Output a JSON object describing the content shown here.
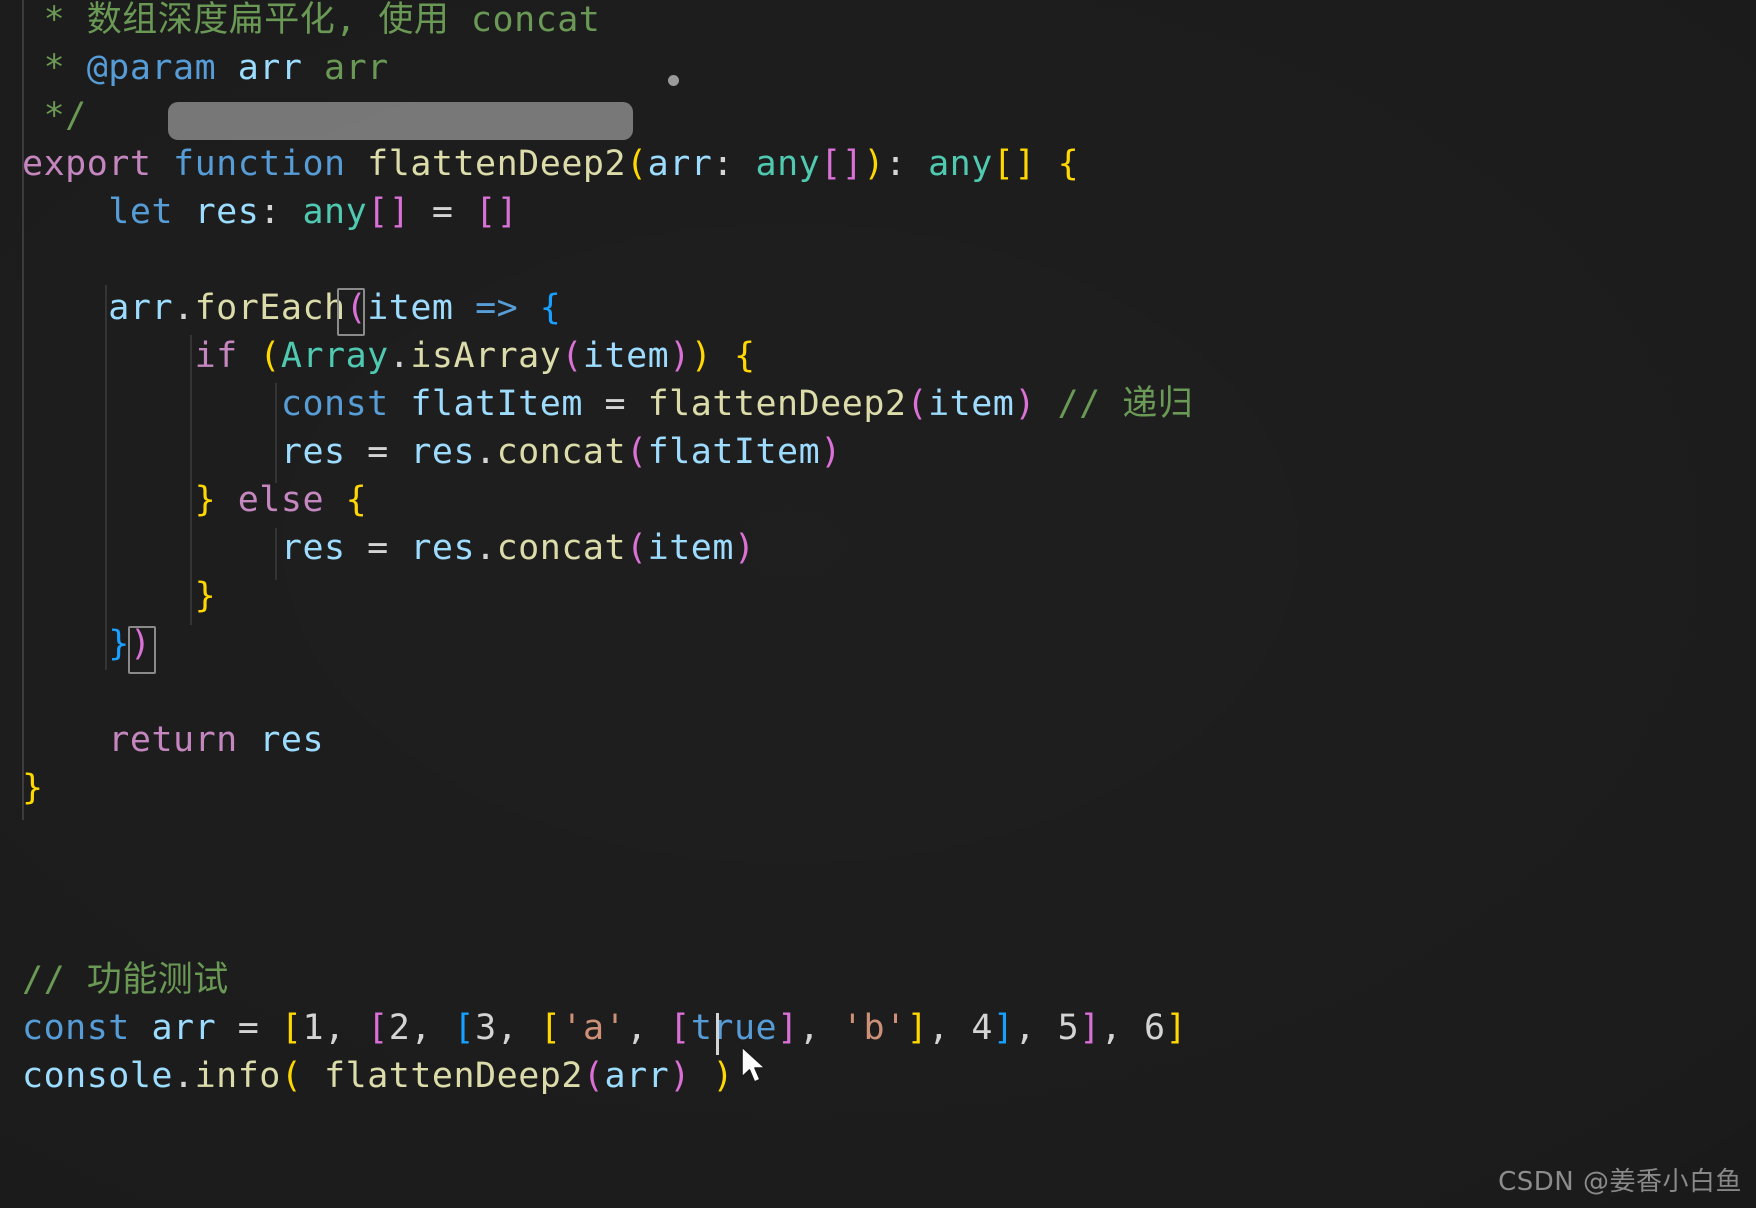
{
  "app": {
    "kind": "code-editor",
    "theme": "dark-plus",
    "language": "TypeScript",
    "background": "#1c1c1c"
  },
  "colors": {
    "background": "#1c1c1c",
    "foreground": "#D4D4D4",
    "comment": "#6A9955",
    "keyword": "#C586C0",
    "keyword_blue": "#569CD6",
    "function": "#DCDCAA",
    "variable": "#9CDCFE",
    "type": "#4EC9B0",
    "number": "#B5CEA8",
    "string": "#CE9178",
    "bracket_level_1": "#FFD700",
    "bracket_level_2": "#DA70D6",
    "bracket_level_3": "#179FFF",
    "indent_guide": "#3b3b3b",
    "redaction": "#777777",
    "watermark": "#9b9b9b"
  },
  "code": {
    "lines": [
      {
        "id": "doc-desc",
        "text": " * 数组深度扁平化, 使用 concat",
        "tokens": [
          {
            "text": " * ",
            "style": "t-comment"
          },
          {
            "text": "数组深度扁平化, 使用 concat",
            "style": "t-doc-text"
          }
        ]
      },
      {
        "id": "doc-param",
        "text": " * @param arr arr",
        "tokens": [
          {
            "text": " * ",
            "style": "t-comment"
          },
          {
            "text": "@param",
            "style": "t-doc-tag"
          },
          {
            "text": " ",
            "style": "t-comment"
          },
          {
            "text": "arr",
            "style": "t-doc-name"
          },
          {
            "text": " ",
            "style": "t-comment"
          },
          {
            "text": "arr",
            "style": "t-doc-text"
          }
        ]
      },
      {
        "id": "doc-close",
        "text": " */",
        "tokens": [
          {
            "text": " */",
            "style": "t-comment"
          }
        ]
      },
      {
        "id": "fn-signature",
        "text": "export function flattenDeep2(arr: any[]): any[] {",
        "tokens": [
          {
            "text": "export",
            "style": "t-keyword"
          },
          {
            "text": " ",
            "style": "t-plain"
          },
          {
            "text": "function",
            "style": "t-keyword2"
          },
          {
            "text": " ",
            "style": "t-plain"
          },
          {
            "text": "flattenDeep2",
            "style": "t-func"
          },
          {
            "text": "(",
            "style": "b1"
          },
          {
            "text": "arr",
            "style": "t-var"
          },
          {
            "text": ": ",
            "style": "t-plain"
          },
          {
            "text": "any",
            "style": "t-type"
          },
          {
            "text": "[",
            "style": "b2"
          },
          {
            "text": "]",
            "style": "b2"
          },
          {
            "text": ")",
            "style": "b1"
          },
          {
            "text": ": ",
            "style": "t-plain"
          },
          {
            "text": "any",
            "style": "t-type"
          },
          {
            "text": "[",
            "style": "b1"
          },
          {
            "text": "]",
            "style": "b1"
          },
          {
            "text": " ",
            "style": "t-plain"
          },
          {
            "text": "{",
            "style": "b1"
          }
        ]
      },
      {
        "id": "let-res",
        "text": "    let res: any[] = []",
        "tokens": [
          {
            "text": "    ",
            "style": "t-plain"
          },
          {
            "text": "let",
            "style": "t-keyword2"
          },
          {
            "text": " ",
            "style": "t-plain"
          },
          {
            "text": "res",
            "style": "t-var"
          },
          {
            "text": ": ",
            "style": "t-plain"
          },
          {
            "text": "any",
            "style": "t-type"
          },
          {
            "text": "[",
            "style": "b2"
          },
          {
            "text": "]",
            "style": "b2"
          },
          {
            "text": " = ",
            "style": "t-plain"
          },
          {
            "text": "[",
            "style": "b2"
          },
          {
            "text": "]",
            "style": "b2"
          }
        ]
      },
      {
        "id": "blank-1",
        "text": "",
        "tokens": []
      },
      {
        "id": "foreach-open",
        "text": "    arr.forEach(item => {",
        "tokens": [
          {
            "text": "    ",
            "style": "t-plain"
          },
          {
            "text": "arr",
            "style": "t-var"
          },
          {
            "text": ".",
            "style": "t-plain"
          },
          {
            "text": "forEach",
            "style": "t-prop"
          },
          {
            "text": "(",
            "style": "b2"
          },
          {
            "text": "item",
            "style": "t-var"
          },
          {
            "text": " ",
            "style": "t-plain"
          },
          {
            "text": "=>",
            "style": "t-keyword2"
          },
          {
            "text": " ",
            "style": "t-plain"
          },
          {
            "text": "{",
            "style": "b3"
          }
        ]
      },
      {
        "id": "if-isarray",
        "text": "        if (Array.isArray(item)) {",
        "tokens": [
          {
            "text": "        ",
            "style": "t-plain"
          },
          {
            "text": "if",
            "style": "t-keyword"
          },
          {
            "text": " ",
            "style": "t-plain"
          },
          {
            "text": "(",
            "style": "b1"
          },
          {
            "text": "Array",
            "style": "t-class"
          },
          {
            "text": ".",
            "style": "t-plain"
          },
          {
            "text": "isArray",
            "style": "t-prop"
          },
          {
            "text": "(",
            "style": "b2"
          },
          {
            "text": "item",
            "style": "t-var"
          },
          {
            "text": ")",
            "style": "b2"
          },
          {
            "text": ")",
            "style": "b1"
          },
          {
            "text": " ",
            "style": "t-plain"
          },
          {
            "text": "{",
            "style": "b1"
          }
        ]
      },
      {
        "id": "const-flatitem",
        "text": "            const flatItem = flattenDeep2(item) // 递归",
        "tokens": [
          {
            "text": "            ",
            "style": "t-plain"
          },
          {
            "text": "const",
            "style": "t-keyword2"
          },
          {
            "text": " ",
            "style": "t-plain"
          },
          {
            "text": "flatItem",
            "style": "t-var"
          },
          {
            "text": " = ",
            "style": "t-plain"
          },
          {
            "text": "flattenDeep2",
            "style": "t-func"
          },
          {
            "text": "(",
            "style": "b2"
          },
          {
            "text": "item",
            "style": "t-var"
          },
          {
            "text": ")",
            "style": "b2"
          },
          {
            "text": " ",
            "style": "t-plain"
          },
          {
            "text": "// 递归",
            "style": "t-comment"
          }
        ]
      },
      {
        "id": "res-concat-flatitem",
        "text": "            res = res.concat(flatItem)",
        "tokens": [
          {
            "text": "            ",
            "style": "t-plain"
          },
          {
            "text": "res",
            "style": "t-var"
          },
          {
            "text": " = ",
            "style": "t-plain"
          },
          {
            "text": "res",
            "style": "t-var"
          },
          {
            "text": ".",
            "style": "t-plain"
          },
          {
            "text": "concat",
            "style": "t-prop"
          },
          {
            "text": "(",
            "style": "b2"
          },
          {
            "text": "flatItem",
            "style": "t-var"
          },
          {
            "text": ")",
            "style": "b2"
          }
        ]
      },
      {
        "id": "else-branch",
        "text": "        } else {",
        "tokens": [
          {
            "text": "        ",
            "style": "t-plain"
          },
          {
            "text": "}",
            "style": "b1"
          },
          {
            "text": " ",
            "style": "t-plain"
          },
          {
            "text": "else",
            "style": "t-keyword"
          },
          {
            "text": " ",
            "style": "t-plain"
          },
          {
            "text": "{",
            "style": "b1"
          }
        ]
      },
      {
        "id": "res-concat-item",
        "text": "            res = res.concat(item)",
        "tokens": [
          {
            "text": "            ",
            "style": "t-plain"
          },
          {
            "text": "res",
            "style": "t-var"
          },
          {
            "text": " = ",
            "style": "t-plain"
          },
          {
            "text": "res",
            "style": "t-var"
          },
          {
            "text": ".",
            "style": "t-plain"
          },
          {
            "text": "concat",
            "style": "t-prop"
          },
          {
            "text": "(",
            "style": "b2"
          },
          {
            "text": "item",
            "style": "t-var"
          },
          {
            "text": ")",
            "style": "b2"
          }
        ]
      },
      {
        "id": "if-close",
        "text": "        }",
        "tokens": [
          {
            "text": "        ",
            "style": "t-plain"
          },
          {
            "text": "}",
            "style": "b1"
          }
        ]
      },
      {
        "id": "foreach-close",
        "text": "    })",
        "tokens": [
          {
            "text": "    ",
            "style": "t-plain"
          },
          {
            "text": "}",
            "style": "b3"
          },
          {
            "text": ")",
            "style": "b2"
          }
        ]
      },
      {
        "id": "blank-2",
        "text": "",
        "tokens": []
      },
      {
        "id": "return-res",
        "text": "    return res",
        "tokens": [
          {
            "text": "    ",
            "style": "t-plain"
          },
          {
            "text": "return",
            "style": "t-keyword"
          },
          {
            "text": " ",
            "style": "t-plain"
          },
          {
            "text": "res",
            "style": "t-var"
          }
        ]
      },
      {
        "id": "fn-close",
        "text": "}",
        "tokens": [
          {
            "text": "}",
            "style": "b1"
          }
        ]
      },
      {
        "id": "blank-3",
        "text": "",
        "tokens": []
      },
      {
        "id": "blank-4",
        "text": "",
        "tokens": []
      },
      {
        "id": "blank-5",
        "text": "",
        "tokens": []
      },
      {
        "id": "test-comment",
        "text": "// 功能测试",
        "tokens": [
          {
            "text": "// 功能测试",
            "style": "t-comment"
          }
        ]
      },
      {
        "id": "const-arr",
        "text": "const arr = [1, [2, [3, ['a', [true], 'b'], 4], 5], 6]",
        "tokens": [
          {
            "text": "const",
            "style": "t-keyword2"
          },
          {
            "text": " ",
            "style": "t-plain"
          },
          {
            "text": "arr",
            "style": "t-var"
          },
          {
            "text": " = ",
            "style": "t-plain"
          },
          {
            "text": "[",
            "style": "b1"
          },
          {
            "text": "1",
            "style": "t-plain"
          },
          {
            "text": ", ",
            "style": "t-plain"
          },
          {
            "text": "[",
            "style": "b2"
          },
          {
            "text": "2",
            "style": "t-plain"
          },
          {
            "text": ", ",
            "style": "t-plain"
          },
          {
            "text": "[",
            "style": "b3"
          },
          {
            "text": "3",
            "style": "t-plain"
          },
          {
            "text": ", ",
            "style": "t-plain"
          },
          {
            "text": "[",
            "style": "b1"
          },
          {
            "text": "'a'",
            "style": "t-string"
          },
          {
            "text": ", ",
            "style": "t-plain"
          },
          {
            "text": "[",
            "style": "b2"
          },
          {
            "text": "true",
            "style": "t-bool"
          },
          {
            "text": "]",
            "style": "b2"
          },
          {
            "text": ", ",
            "style": "t-plain"
          },
          {
            "text": "'b'",
            "style": "t-string"
          },
          {
            "text": "]",
            "style": "b1"
          },
          {
            "text": ", ",
            "style": "t-plain"
          },
          {
            "text": "4",
            "style": "t-plain"
          },
          {
            "text": "]",
            "style": "b3"
          },
          {
            "text": ", ",
            "style": "t-plain"
          },
          {
            "text": "5",
            "style": "t-plain"
          },
          {
            "text": "]",
            "style": "b2"
          },
          {
            "text": ", ",
            "style": "t-plain"
          },
          {
            "text": "6",
            "style": "t-plain"
          },
          {
            "text": "]",
            "style": "b1"
          }
        ]
      },
      {
        "id": "console-info",
        "text": "console.info( flattenDeep2(arr) )",
        "tokens": [
          {
            "text": "console",
            "style": "t-var"
          },
          {
            "text": ".",
            "style": "t-plain"
          },
          {
            "text": "info",
            "style": "t-prop"
          },
          {
            "text": "(",
            "style": "b1"
          },
          {
            "text": " ",
            "style": "t-plain"
          },
          {
            "text": "flattenDeep2",
            "style": "t-func"
          },
          {
            "text": "(",
            "style": "b2"
          },
          {
            "text": "arr",
            "style": "t-var"
          },
          {
            "text": ")",
            "style": "b2"
          },
          {
            "text": " ",
            "style": "t-plain"
          },
          {
            "text": ")",
            "style": "b1"
          }
        ]
      }
    ]
  },
  "overlays": {
    "redaction_box": {
      "label": "redaction-overlay",
      "color": "#777777"
    },
    "dot_marker": {
      "label": "dot-marker",
      "color": "#9a9a9a"
    },
    "bracket_match_open": {
      "label": "bracket-match-forEach-open"
    },
    "bracket_match_close": {
      "label": "bracket-match-forEach-close"
    },
    "caret": {
      "label": "text-caret",
      "color": "#d4d4d4"
    },
    "mouse_pointer": {
      "label": "mouse-pointer"
    }
  },
  "watermark": {
    "text": "CSDN @姜香小白鱼"
  }
}
